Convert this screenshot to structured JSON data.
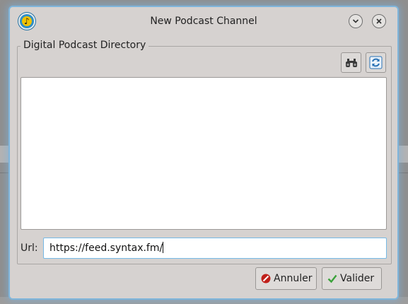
{
  "window": {
    "title": "New Podcast Channel",
    "app_icon": "podcast-app-icon",
    "minimize_icon": "chevron-down-icon",
    "close_icon": "close-icon"
  },
  "directory": {
    "group_label": "Digital Podcast Directory",
    "find_icon": "binoculars-icon",
    "refresh_icon": "refresh-icon",
    "items": []
  },
  "url": {
    "label": "Url:",
    "value": "https://feed.syntax.fm/"
  },
  "buttons": {
    "cancel_label": "Annuler",
    "ok_label": "Valider"
  },
  "colors": {
    "dialog_bg": "#d6d2d0",
    "focus_border": "#76b9e6",
    "cancel_icon": "#c0201a",
    "ok_icon": "#3aa23a"
  }
}
